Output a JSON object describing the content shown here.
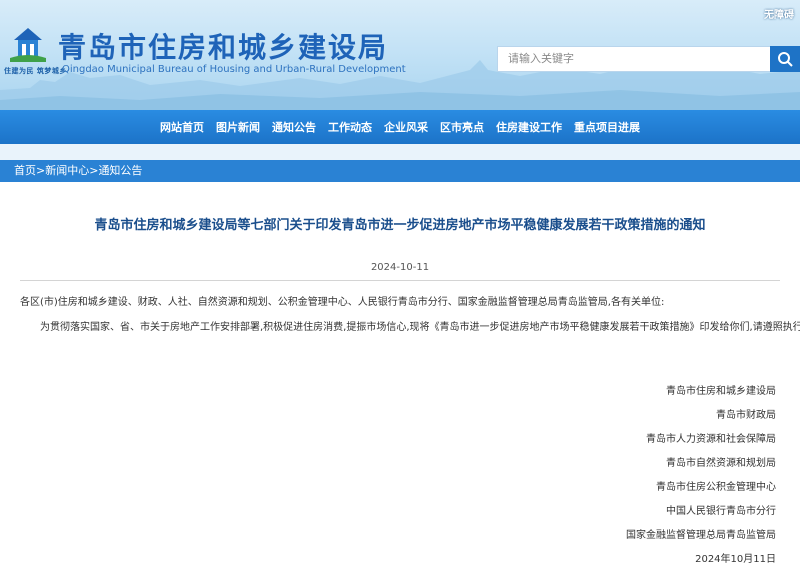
{
  "header": {
    "accessibility_label": "无障碍",
    "site_title": "青岛市住房和城乡建设局",
    "site_subtitle": "Qingdao Municipal Bureau of Housing and Urban-Rural Development",
    "logo_slogan": "住建为民 筑梦城乡",
    "search_placeholder": "请输入关键字",
    "colors": {
      "banner": "#bfe0f5",
      "title": "#1e63b8",
      "nav": "#1c73c8"
    }
  },
  "nav": {
    "items": [
      {
        "label": "网站首页"
      },
      {
        "label": "图片新闻"
      },
      {
        "label": "通知公告"
      },
      {
        "label": "工作动态"
      },
      {
        "label": "企业风采"
      },
      {
        "label": "区市亮点"
      },
      {
        "label": "住房建设工作"
      },
      {
        "label": "重点项目进展"
      }
    ]
  },
  "breadcrumb": {
    "home": "首页",
    "sep1": ">",
    "news": "新闻中心",
    "sep2": ">",
    "current": "通知公告"
  },
  "article": {
    "title": "青岛市住房和城乡建设局等七部门关于印发青岛市进一步促进房地产市场平稳健康发展若干政策措施的通知",
    "date": "2024-10-11",
    "addressee": "各区(市)住房和城乡建设、财政、人社、自然资源和规划、公积金管理中心、人民银行青岛市分行、国家金融监督管理总局青岛监管局,各有关单位:",
    "body": "为贯彻落实国家、省、市关于房地产工作安排部署,积极促进住房消费,提振市场信心,现将《青岛市进一步促进房地产市场平稳健康发展若干政策措施》印发给你们,请遵照执行。",
    "signatories": [
      "青岛市住房和城乡建设局",
      "青岛市财政局",
      "青岛市人力资源和社会保障局",
      "青岛市自然资源和规划局",
      "青岛市住房公积金管理中心",
      "中国人民银行青岛市分行",
      "国家金融监督管理总局青岛监管局"
    ],
    "sign_date": "2024年10月11日"
  }
}
